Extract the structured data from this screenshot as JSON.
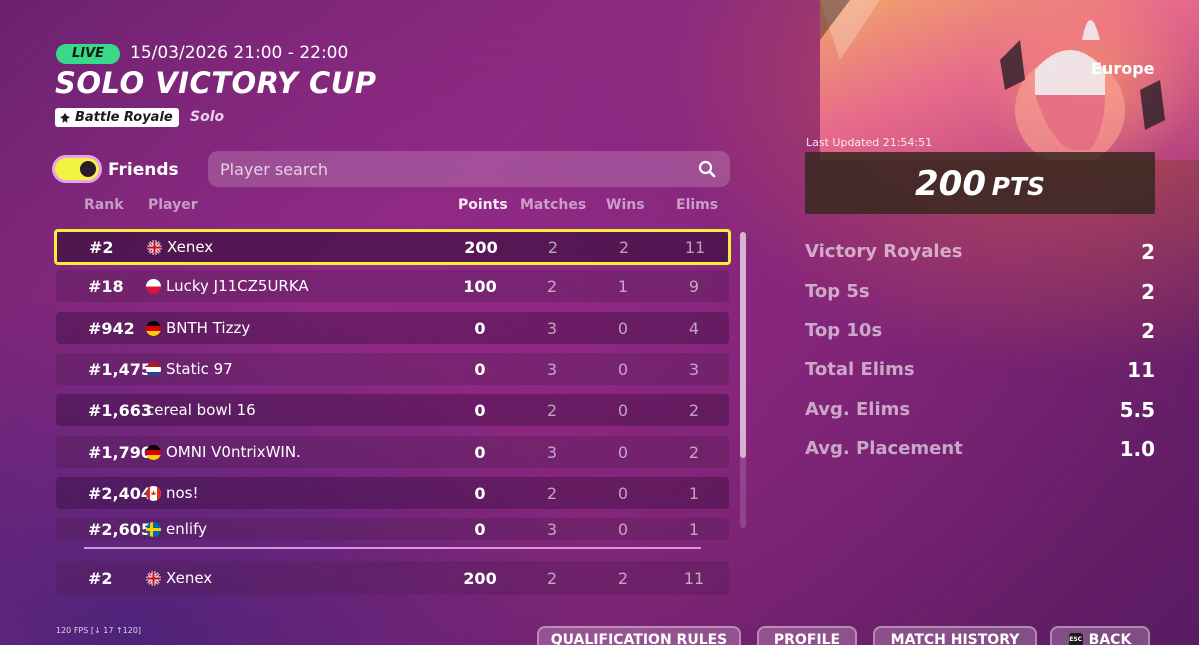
{
  "header": {
    "live": "LIVE",
    "datetime": "15/03/2026 21:00 - 22:00",
    "title": "SOLO VICTORY CUP",
    "mode_badge": "Battle Royale",
    "mode_sub": "Solo"
  },
  "filters": {
    "friends_label": "Friends",
    "friends_toggle_on": true,
    "search_placeholder": "Player search"
  },
  "table": {
    "headers": {
      "rank": "Rank",
      "player": "Player",
      "points": "Points",
      "matches": "Matches",
      "wins": "Wins",
      "elims": "Elims"
    },
    "rows": [
      {
        "rank": "#2",
        "flag": "gb",
        "player": "Xenex",
        "points": "200",
        "matches": "2",
        "wins": "2",
        "elims": "11"
      },
      {
        "rank": "#18",
        "flag": "pl",
        "player": "Lucky J11CZ5URKA",
        "points": "100",
        "matches": "2",
        "wins": "1",
        "elims": "9"
      },
      {
        "rank": "#942",
        "flag": "de",
        "player": "BNTH Tizzy",
        "points": "0",
        "matches": "3",
        "wins": "0",
        "elims": "4"
      },
      {
        "rank": "#1,475",
        "flag": "nl",
        "player": "Static 97",
        "points": "0",
        "matches": "3",
        "wins": "0",
        "elims": "3"
      },
      {
        "rank": "#1,663",
        "flag": "",
        "player": "cereal bowl 16",
        "points": "0",
        "matches": "2",
        "wins": "0",
        "elims": "2"
      },
      {
        "rank": "#1,790",
        "flag": "de",
        "player": "OMNI V0ntrixWIN.",
        "points": "0",
        "matches": "3",
        "wins": "0",
        "elims": "2"
      },
      {
        "rank": "#2,404",
        "flag": "ca",
        "player": "nos!",
        "points": "0",
        "matches": "2",
        "wins": "0",
        "elims": "1"
      },
      {
        "rank": "#2,605",
        "flag": "se",
        "player": "enlify",
        "points": "0",
        "matches": "3",
        "wins": "0",
        "elims": "1"
      }
    ],
    "self_row": {
      "rank": "#2",
      "flag": "gb",
      "player": "Xenex",
      "points": "200",
      "matches": "2",
      "wins": "2",
      "elims": "11"
    }
  },
  "summary": {
    "region": "Europe",
    "last_updated": "Last Updated 21:54:51",
    "points_value": "200",
    "points_unit": "PTS",
    "stats": [
      {
        "label": "Victory Royales",
        "value": "2"
      },
      {
        "label": "Top 5s",
        "value": "2"
      },
      {
        "label": "Top 10s",
        "value": "2"
      },
      {
        "label": "Total Elims",
        "value": "11"
      },
      {
        "label": "Avg. Elims",
        "value": "5.5"
      },
      {
        "label": "Avg. Placement",
        "value": "1.0"
      }
    ]
  },
  "footer": {
    "fps": "120 FPS [↓ 17 ↑120]",
    "buttons": [
      "QUALIFICATION RULES",
      "PROFILE",
      "MATCH HISTORY",
      "BACK"
    ],
    "esc_key": "ESC"
  },
  "colors": {
    "highlight": "#f5ef3a",
    "live": "#39d98a",
    "toggle": "#f2f243"
  }
}
